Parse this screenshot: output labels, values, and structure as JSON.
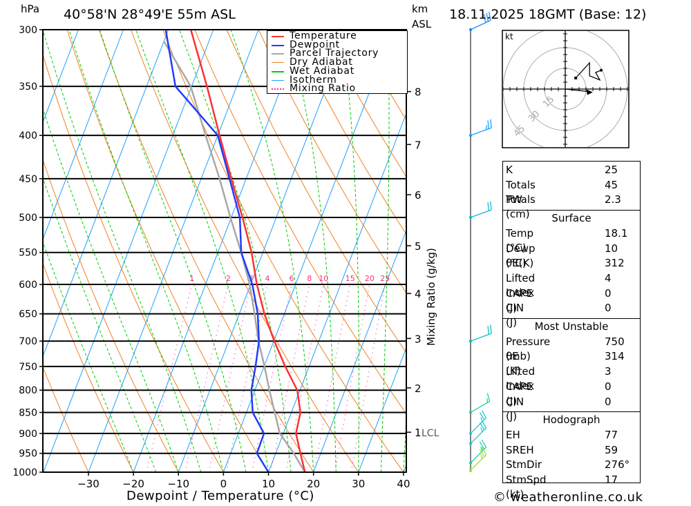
{
  "header": {
    "pressure_unit": "hPa",
    "location": "40°58'N 28°49'E 55m ASL",
    "height_unit_1": "km",
    "height_unit_2": "ASL",
    "datetime": "18.11.2025 18GMT (Base: 12)"
  },
  "legend": [
    {
      "label": "Temperature",
      "color": "#ff3030",
      "style": "solid"
    },
    {
      "label": "Dewpoint",
      "color": "#1f3cff",
      "style": "solid"
    },
    {
      "label": "Parcel Trajectory",
      "color": "#a8a8a8",
      "style": "solid"
    },
    {
      "label": "Dry Adiabat",
      "color": "#f08020",
      "style": "thin"
    },
    {
      "label": "Wet Adiabat",
      "color": "#00cc00",
      "style": "dashed"
    },
    {
      "label": "Isotherm",
      "color": "#1aa0ff",
      "style": "thin"
    },
    {
      "label": "Mixing Ratio",
      "color": "#ff2aa0",
      "style": "dotted"
    }
  ],
  "chart_data": {
    "type": "skew-t",
    "xlabel": "Dewpoint / Temperature (°C)",
    "ylabel": "hPa",
    "xlim": [
      -40,
      40
    ],
    "ylim": [
      1000,
      300
    ],
    "pressure_ticks": [
      300,
      350,
      400,
      450,
      500,
      550,
      600,
      650,
      700,
      750,
      800,
      850,
      900,
      950,
      1000
    ],
    "temperature_ticks": [
      -30,
      -20,
      -10,
      0,
      10,
      20,
      30,
      40
    ],
    "height_ticks_km": [
      {
        "km": "8",
        "p": 355
      },
      {
        "km": "7",
        "p": 410
      },
      {
        "km": "6",
        "p": 470
      },
      {
        "km": "5",
        "p": 540
      },
      {
        "km": "4",
        "p": 615
      },
      {
        "km": "3",
        "p": 695
      },
      {
        "km": "2",
        "p": 795
      },
      {
        "km": "1",
        "p": 897
      }
    ],
    "lcl_label": "LCL",
    "lcl_pressure": 897,
    "mixing_ratio_axis_label": "Mixing Ratio (g/kg)",
    "mixing_ratio_labels": [
      "1",
      "2",
      "3",
      "4",
      "6",
      "8",
      "10",
      "15",
      "20",
      "25"
    ],
    "mixing_ratio_label_pressure": 600,
    "temperature": [
      [
        1000,
        18.1
      ],
      [
        950,
        15.5
      ],
      [
        900,
        12.8
      ],
      [
        850,
        12.0
      ],
      [
        800,
        9.4
      ],
      [
        750,
        4.7
      ],
      [
        700,
        0.1
      ],
      [
        650,
        -4.4
      ],
      [
        600,
        -8.6
      ],
      [
        550,
        -12.5
      ],
      [
        500,
        -17.5
      ],
      [
        450,
        -23.3
      ],
      [
        400,
        -29.6
      ],
      [
        350,
        -36.6
      ],
      [
        300,
        -45.0
      ]
    ],
    "dewpoint": [
      [
        1000,
        10.0
      ],
      [
        950,
        5.8
      ],
      [
        900,
        5.7
      ],
      [
        850,
        1.4
      ],
      [
        800,
        -0.8
      ],
      [
        750,
        -1.9
      ],
      [
        700,
        -3.3
      ],
      [
        650,
        -5.9
      ],
      [
        600,
        -9.6
      ],
      [
        550,
        -14.8
      ],
      [
        500,
        -18.1
      ],
      [
        450,
        -23.7
      ],
      [
        400,
        -30.0
      ],
      [
        350,
        -43.6
      ],
      [
        300,
        -50.6
      ]
    ],
    "parcel": [
      [
        1000,
        18.1
      ],
      [
        950,
        14.0
      ],
      [
        900,
        9.2
      ],
      [
        850,
        6.3
      ],
      [
        800,
        3.2
      ],
      [
        750,
        0.1
      ],
      [
        700,
        -3.4
      ],
      [
        650,
        -6.6
      ],
      [
        600,
        -10.2
      ],
      [
        550,
        -14.8
      ],
      [
        500,
        -20.2
      ],
      [
        450,
        -25.9
      ],
      [
        400,
        -32.7
      ],
      [
        350,
        -40.2
      ],
      [
        310,
        -49.9
      ]
    ],
    "wind_barbs": [
      {
        "p": 300,
        "dir": 245,
        "kt": 30,
        "color": "#1a8cff"
      },
      {
        "p": 400,
        "dir": 250,
        "kt": 25,
        "color": "#1aa0ff"
      },
      {
        "p": 500,
        "dir": 250,
        "kt": 20,
        "color": "#10b8d0"
      },
      {
        "p": 700,
        "dir": 250,
        "kt": 20,
        "color": "#10c0c0"
      },
      {
        "p": 850,
        "dir": 240,
        "kt": 15,
        "color": "#20d090"
      },
      {
        "p": 900,
        "dir": 225,
        "kt": 25,
        "color": "#20c8d0"
      },
      {
        "p": 925,
        "dir": 225,
        "kt": 25,
        "color": "#20c8d0"
      },
      {
        "p": 975,
        "dir": 225,
        "kt": 25,
        "color": "#20d0a0"
      },
      {
        "p": 995,
        "dir": 225,
        "kt": 25,
        "color": "#a0e040"
      }
    ]
  },
  "hodograph": {
    "unit": "kt",
    "rings": [
      "15",
      "30",
      "45"
    ],
    "points_kt": [
      [
        7.6,
        8
      ],
      [
        17.6,
        19
      ],
      [
        17.6,
        9.6
      ],
      [
        25,
        6.6
      ],
      [
        22,
        12
      ],
      [
        26,
        13.6
      ]
    ],
    "storm_motion_kt": [
      16.9,
      -1.8
    ]
  },
  "stats": {
    "general": [
      {
        "label": "K",
        "value": "25"
      },
      {
        "label": "Totals Totals",
        "value": "45"
      },
      {
        "label": "PW (cm)",
        "value": "2.3"
      }
    ],
    "surface": {
      "title": "Surface",
      "rows": [
        {
          "label": "Temp (°C)",
          "value": "18.1"
        },
        {
          "label": "Dewp (°C)",
          "value": "10"
        },
        {
          "label": "θE(K)",
          "value": "312"
        },
        {
          "label": "Lifted Index",
          "value": "4"
        },
        {
          "label": "CAPE (J)",
          "value": "0"
        },
        {
          "label": "CIN (J)",
          "value": "0"
        }
      ]
    },
    "most_unstable": {
      "title": "Most Unstable",
      "rows": [
        {
          "label": "Pressure (mb)",
          "value": "750"
        },
        {
          "label": "θE (K)",
          "value": "314"
        },
        {
          "label": "Lifted Index",
          "value": "3"
        },
        {
          "label": "CAPE (J)",
          "value": "0"
        },
        {
          "label": "CIN (J)",
          "value": "0"
        }
      ]
    },
    "hodograph": {
      "title": "Hodograph",
      "rows": [
        {
          "label": "EH",
          "value": "77"
        },
        {
          "label": "SREH",
          "value": "59"
        },
        {
          "label": "StmDir",
          "value": "276°"
        },
        {
          "label": "StmSpd (kt)",
          "value": "17"
        }
      ]
    }
  },
  "footer": {
    "copyright": "© weatheronline.co.uk"
  }
}
